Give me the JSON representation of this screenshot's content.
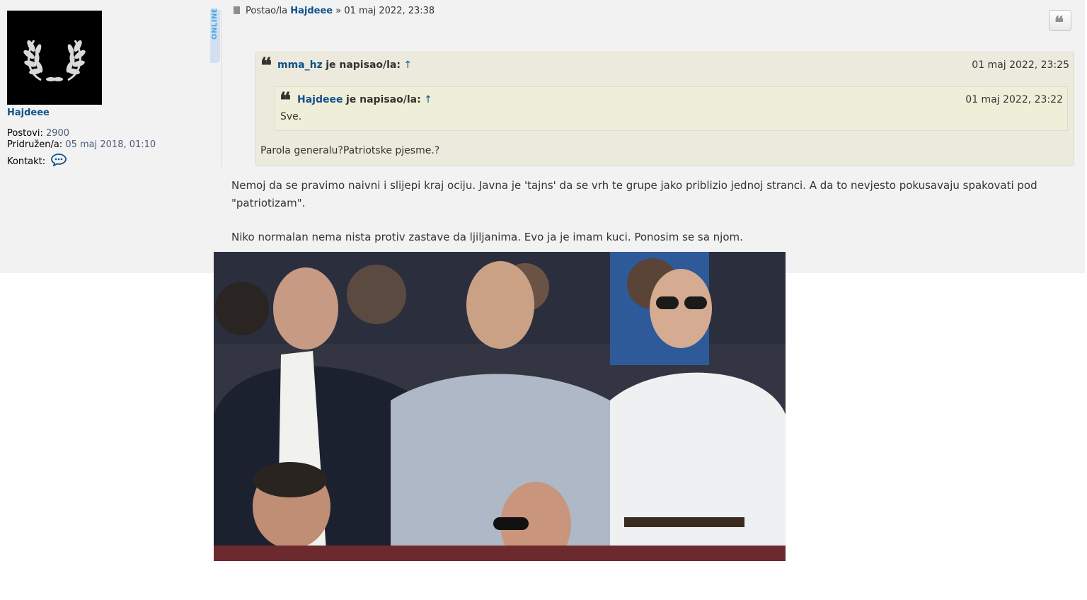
{
  "post": {
    "author": "Hajdeee",
    "online_badge": "ONLINE",
    "prefix": "Postao/la",
    "separator": "»",
    "date": "01 maj 2022, 23:38",
    "quote_button_icon": "quote-icon",
    "file_icon": "file-icon"
  },
  "profile": {
    "username": "Hajdeee",
    "posts_label": "Postovi:",
    "posts_value": "2900",
    "joined_label": "Pridružen/a:",
    "joined_value": "05 maj 2018, 01:10",
    "contact_label": "Kontakt:",
    "contact_icon": "chat-icon"
  },
  "quote_outer": {
    "author": "mma_hz",
    "verb": "je napisao/la:",
    "arrow": "↑",
    "date": "01 maj 2022, 23:25",
    "text": "Parola generalu?Patriotske pjesme.?"
  },
  "quote_inner": {
    "author": "Hajdeee",
    "verb": "je napisao/la:",
    "arrow": "↑",
    "date": "01 maj 2022, 23:22",
    "text": "Sve."
  },
  "body": {
    "paragraph1": "Nemoj da se pravimo naivni i slijepi kraj ociju. Javna je 'tajns' da se vrh te grupe jako priblizio jednoj stranci. A da to nevjesto pokusavaju spakovati pod \"patriotizam\".",
    "paragraph2": "Niko normalan nema nista protiv zastave da ljiljanima. Evo ja je imam kuci. Ponosim se sa njom."
  },
  "colors": {
    "link": "#105289",
    "post_bg": "#f2f2f2",
    "quote_bg": "#ebeadd",
    "quote_inner_bg": "#efeed9"
  }
}
